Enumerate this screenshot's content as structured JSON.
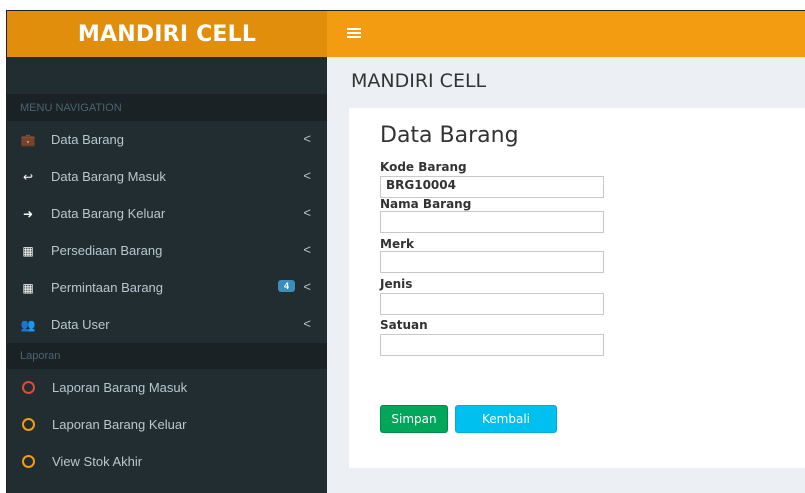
{
  "logo": "MANDIRI CELL",
  "header": {
    "toggle_icon": "hamburger-icon"
  },
  "sidebar": {
    "nav_header": "MENU NAVIGATION",
    "items": [
      {
        "label": "Data Barang",
        "icon": "briefcase-icon",
        "glyph": "💼"
      },
      {
        "label": "Data Barang Masuk",
        "icon": "reply-all-icon",
        "glyph": "↩"
      },
      {
        "label": "Data Barang Keluar",
        "icon": "sign-out-icon",
        "glyph": "➜"
      },
      {
        "label": "Persediaan Barang",
        "icon": "table-icon",
        "glyph": "▦"
      },
      {
        "label": "Permintaan Barang",
        "icon": "table-icon",
        "glyph": "▦",
        "badge": "4"
      },
      {
        "label": "Data User",
        "icon": "users-icon",
        "glyph": "👥"
      }
    ],
    "report_header": "Laporan",
    "reports": [
      {
        "label": "Laporan Barang Masuk",
        "color": "#dd4b39"
      },
      {
        "label": "Laporan Barang Keluar",
        "color": "#f39c12"
      },
      {
        "label": "View Stok Akhir",
        "color": "#f39c12"
      }
    ]
  },
  "main": {
    "page_title": "MANDIRI CELL",
    "box_title": "Data Barang",
    "fields": [
      {
        "label": "Kode Barang",
        "value": "BRG10004"
      },
      {
        "label": "Nama Barang",
        "value": ""
      },
      {
        "label": "Merk",
        "value": ""
      },
      {
        "label": "Jenis",
        "value": ""
      },
      {
        "label": "Satuan",
        "value": ""
      }
    ],
    "save_label": "Simpan",
    "back_label": "Kembali"
  },
  "colors": {
    "accent": "#f39c12",
    "sidebar": "#222d32",
    "success": "#00a65a",
    "info": "#00c0ef"
  }
}
